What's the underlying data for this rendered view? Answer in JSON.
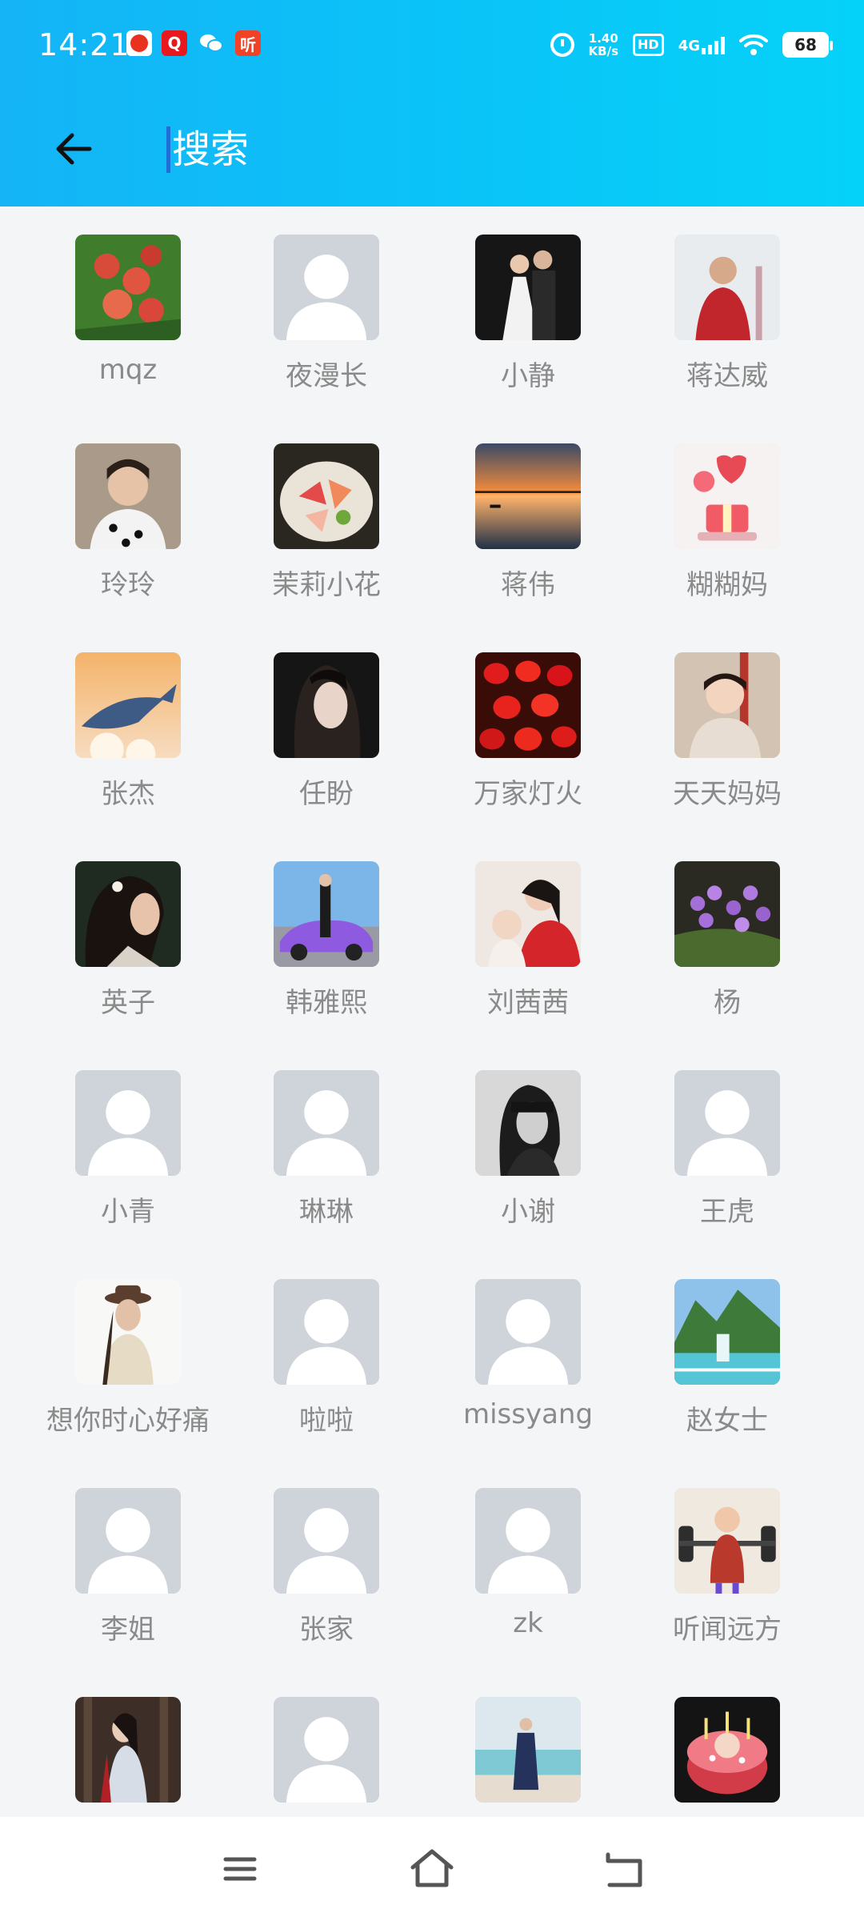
{
  "status_bar": {
    "time": "14:21",
    "notifications": [
      "app-notification-icon",
      "q-app-icon",
      "wechat-icon",
      "listen-app-icon"
    ],
    "q_label": "Q",
    "listen_label": "听",
    "speed_value": "1.40",
    "speed_unit": "KB/s",
    "hd_label": "HD",
    "network_label": "4G",
    "battery": "68"
  },
  "search": {
    "placeholder": "搜索"
  },
  "contacts": [
    {
      "name": "mqz",
      "avatar": "peach-photo"
    },
    {
      "name": "夜漫长",
      "avatar": "default"
    },
    {
      "name": "小静",
      "avatar": "wedding-photo"
    },
    {
      "name": "蒋达威",
      "avatar": "man-red-jacket-photo"
    },
    {
      "name": "玲玲",
      "avatar": "woman-portrait-photo"
    },
    {
      "name": "茉莉小花",
      "avatar": "sashimi-platter-photo"
    },
    {
      "name": "蒋伟",
      "avatar": "sunset-lake-photo"
    },
    {
      "name": "糊糊妈",
      "avatar": "gift-balloons-illustration"
    },
    {
      "name": "张杰",
      "avatar": "flying-whale-illustration"
    },
    {
      "name": "任盼",
      "avatar": "dark-hair-woman-photo"
    },
    {
      "name": "万家灯火",
      "avatar": "red-lanterns-photo"
    },
    {
      "name": "天天妈妈",
      "avatar": "little-girl-photo"
    },
    {
      "name": "英子",
      "avatar": "woman-profile-photo"
    },
    {
      "name": "韩雅熙",
      "avatar": "woman-purple-car-photo"
    },
    {
      "name": "刘茜茜",
      "avatar": "mother-child-photo"
    },
    {
      "name": "杨",
      "avatar": "purple-flowers-photo"
    },
    {
      "name": "小青",
      "avatar": "default"
    },
    {
      "name": "琳琳",
      "avatar": "default"
    },
    {
      "name": "小谢",
      "avatar": "bw-woman-photo"
    },
    {
      "name": "王虎",
      "avatar": "default"
    },
    {
      "name": "想你时心好痛",
      "avatar": "woman-hat-photo"
    },
    {
      "name": "啦啦",
      "avatar": "default"
    },
    {
      "name": "missyang",
      "avatar": "default"
    },
    {
      "name": "赵女士",
      "avatar": "mountain-waterfall-photo"
    },
    {
      "name": "李姐",
      "avatar": "default"
    },
    {
      "name": "张家",
      "avatar": "default"
    },
    {
      "name": "zk",
      "avatar": "default"
    },
    {
      "name": "听闻远方",
      "avatar": "weightlifting-kid-illustration"
    },
    {
      "name": "",
      "avatar": "woman-forest-photo"
    },
    {
      "name": "",
      "avatar": "default"
    },
    {
      "name": "",
      "avatar": "woman-beach-photo"
    },
    {
      "name": "",
      "avatar": "birthday-cake-photo"
    }
  ],
  "colors": {
    "header_start": "#14b4f6",
    "header_end": "#05d2f8",
    "background": "#f4f5f7",
    "name_text": "#8a8a8a",
    "default_avatar_bg": "#cfd3da"
  },
  "nav_bar": {
    "items": [
      "menu-icon",
      "home-icon",
      "back-icon"
    ]
  }
}
